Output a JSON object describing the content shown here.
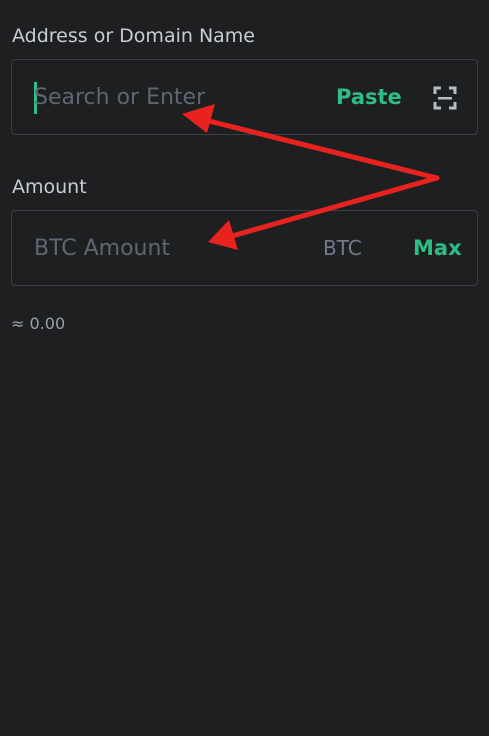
{
  "address_section": {
    "label": "Address or Domain Name",
    "placeholder": "Search or Enter",
    "paste_label": "Paste",
    "scan_icon": "scan-qr-icon"
  },
  "amount_section": {
    "label": "Amount",
    "placeholder": "BTC Amount",
    "unit": "BTC",
    "max_label": "Max"
  },
  "estimate": {
    "value": "≈ 0.00"
  },
  "annotation": {
    "arrow_color": "#e8231f"
  },
  "colors": {
    "background": "#1e1f21",
    "accent_green": "#2ebd85",
    "border": "#3a3d43",
    "placeholder": "#5e6673"
  }
}
